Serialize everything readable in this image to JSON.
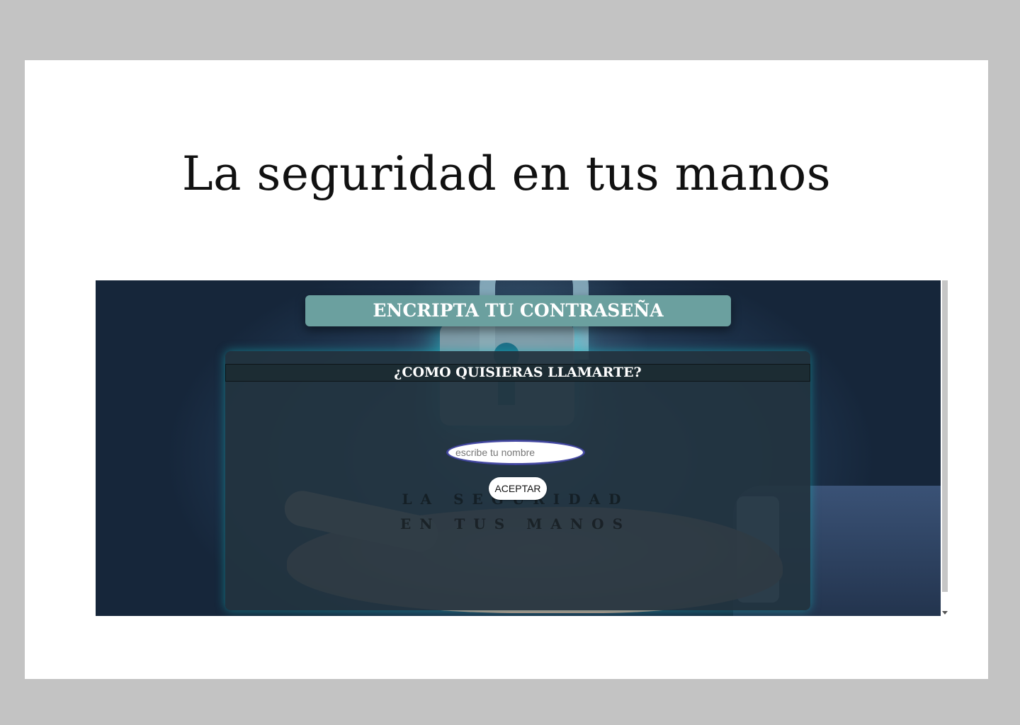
{
  "slide": {
    "title": "La seguridad en tus manos"
  },
  "app": {
    "banner_title": "ENCRIPTA TU CONTRASEÑA",
    "panel_heading": "¿COMO QUISIERAS LLAMARTE?",
    "watermark": "LA SEGURIDAD EN TUS MANOS",
    "name_input": {
      "placeholder": "escribe tu nombre",
      "value": ""
    },
    "accept_label": "ACEPTAR"
  },
  "colors": {
    "page_background": "#c3c3c3",
    "banner": "#6ba09f",
    "panel": "#223440",
    "glow": "#14aab4"
  },
  "icons": [
    "lock-illustration",
    "hand-illustration"
  ]
}
